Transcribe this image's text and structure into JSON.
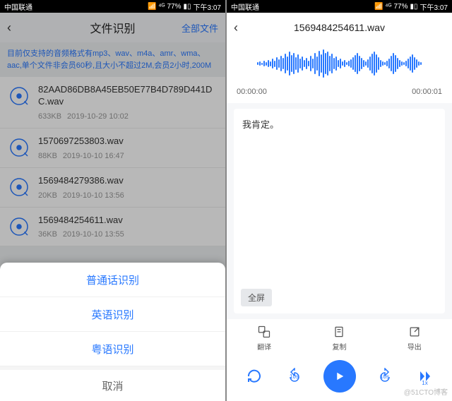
{
  "status": {
    "carrier": "中国联通",
    "battery": "77%",
    "time": "下午3:07"
  },
  "left": {
    "nav": {
      "title": "文件识别",
      "right": "全部文件"
    },
    "hint": "目前仅支持的音频格式有mp3、wav、m4a、amr、wma、aac,单个文件非会员60秒,且大小不超过2M,会员2小时,200M",
    "files": [
      {
        "name": "82AAD86DB8A45EB50E77B4D789D441DC.wav",
        "size": "633KB",
        "date": "2019-10-29 10:02"
      },
      {
        "name": "1570697253803.wav",
        "size": "88KB",
        "date": "2019-10-10 16:47"
      },
      {
        "name": "1569484279386.wav",
        "size": "20KB",
        "date": "2019-10-10 13:56"
      },
      {
        "name": "1569484254611.wav",
        "size": "36KB",
        "date": "2019-10-10 13:55"
      }
    ],
    "sheet": {
      "opt1": "普通话识别",
      "opt2": "英语识别",
      "opt3": "粤语识别",
      "cancel": "取消"
    }
  },
  "right": {
    "nav": {
      "title": "1569484254611.wav"
    },
    "time": {
      "start": "00:00:00",
      "end": "00:00:01"
    },
    "transcript": "我肯定。",
    "fullscreen": "全屏",
    "tools": {
      "translate": "翻译",
      "copy": "复制",
      "export": "导出"
    },
    "controls": {
      "rewind": "10s",
      "forward": "10s",
      "speed": "1x"
    }
  },
  "watermark": "@51CTO博客",
  "waveform_heights": [
    4,
    6,
    3,
    8,
    5,
    10,
    7,
    14,
    9,
    18,
    12,
    22,
    16,
    28,
    20,
    34,
    24,
    30,
    18,
    26,
    14,
    20,
    10,
    16,
    8,
    22,
    14,
    30,
    20,
    36,
    26,
    40,
    30,
    34,
    22,
    28,
    16,
    20,
    10,
    14,
    6,
    10,
    4,
    8,
    12,
    18,
    24,
    30,
    22,
    16,
    10,
    6,
    12,
    20,
    28,
    34,
    26,
    18,
    10,
    6,
    4,
    8,
    14,
    22,
    30,
    24,
    16,
    10,
    6,
    4,
    8,
    14,
    20,
    26,
    18,
    12,
    6,
    4
  ]
}
